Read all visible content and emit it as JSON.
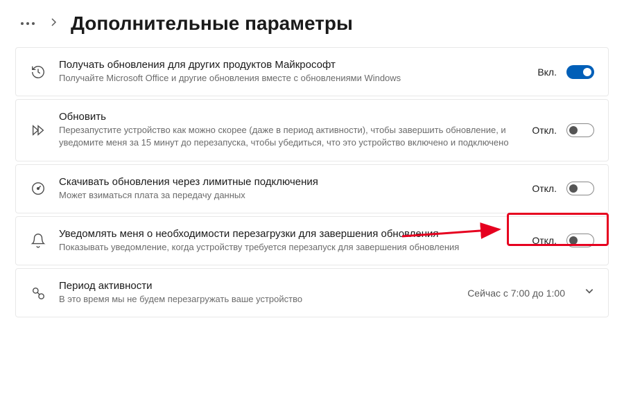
{
  "header": {
    "title": "Дополнительные параметры"
  },
  "settings": {
    "item0": {
      "title": "Получать обновления для других продуктов Майкрософт",
      "desc": "Получайте Microsoft Office и другие обновления вместе с обновлениями Windows",
      "toggle_label": "Вкл."
    },
    "item1": {
      "title": "Обновить",
      "desc": "Перезапустите устройство как можно скорее (даже в период активности), чтобы завершить обновление, и уведомите меня за 15 минут до перезапуска, чтобы убедиться, что это устройство включено и подключено",
      "toggle_label": "Откл."
    },
    "item2": {
      "title": "Скачивать обновления через лимитные подключения",
      "desc": "Может взиматься плата за передачу данных",
      "toggle_label": "Откл."
    },
    "item3": {
      "title": "Уведомлять меня о необходимости перезагрузки для завершения обновления",
      "desc": "Показывать уведомление, когда устройству требуется перезапуск для завершения обновления",
      "toggle_label": "Откл."
    },
    "item4": {
      "title": "Период активности",
      "desc": "В это время мы не будем перезагружать ваше устройство",
      "status": "Сейчас с 7:00 до 1:00"
    }
  }
}
